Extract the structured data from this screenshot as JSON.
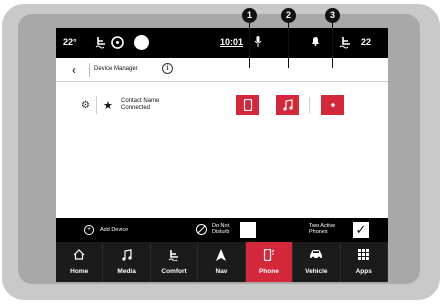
{
  "status_bar": {
    "temp_left": "22°",
    "time": "10:01",
    "temp_right": "22"
  },
  "header": {
    "back_label": "‹",
    "title": "Device Manager",
    "info_label": "i"
  },
  "device": {
    "name_line1": "Contact Name",
    "name_line2": "Connected",
    "buttons": [
      "phone-icon",
      "music-note-icon",
      "media-icon"
    ]
  },
  "callouts": [
    "1",
    "2",
    "3"
  ],
  "actions": {
    "add_icon": "+",
    "add_label": "Add Device",
    "dnd_line1": "Do Not",
    "dnd_line2": "Disturb",
    "two_line1": "Two Active",
    "two_line2": "Phones",
    "two_check": "✓"
  },
  "nav": [
    {
      "label": "Home",
      "icon": "home-icon"
    },
    {
      "label": "Media",
      "icon": "music-note-icon"
    },
    {
      "label": "Comfort",
      "icon": "seat-icon"
    },
    {
      "label": "Nav",
      "icon": "nav-arrow-icon"
    },
    {
      "label": "Phone",
      "icon": "phone-icon",
      "active": true
    },
    {
      "label": "Vehicle",
      "icon": "car-icon"
    },
    {
      "label": "Apps",
      "icon": "apps-grid-icon"
    }
  ],
  "colors": {
    "accent": "#d4283a",
    "screen_bg": "#000000",
    "content_bg": "#ffffff",
    "nav_bg": "#1b1b1b"
  }
}
